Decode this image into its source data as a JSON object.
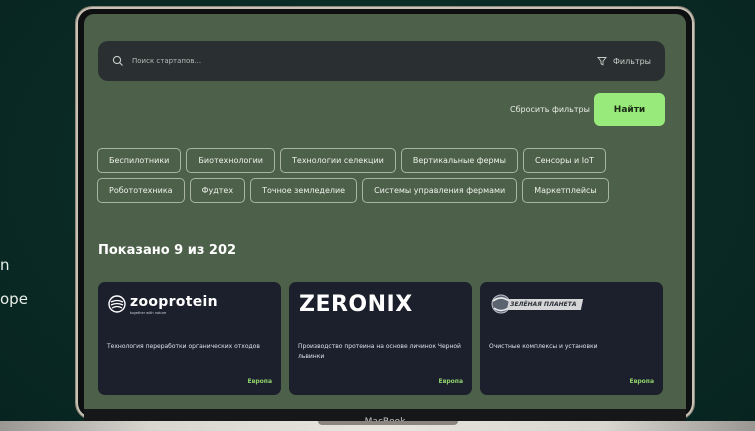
{
  "side_text": {
    "line1": "n",
    "line2": "ope"
  },
  "search": {
    "placeholder": "Поиск стартапов...",
    "value": ""
  },
  "filters": {
    "label": "Фильтры"
  },
  "actions": {
    "reset_label": "Сбросить фильтры",
    "find_label": "Найти"
  },
  "categories": [
    [
      "Беспилотники",
      "Биотехнологии",
      "Технологии селекции",
      "Вертикальные фермы",
      "Сенсоры и IoT"
    ],
    [
      "Робототехника",
      "Фудтех",
      "Точное земледелие",
      "Системы управления фермами",
      "Маркетплейсы"
    ]
  ],
  "results": {
    "title": "Показано 9 из 202"
  },
  "cards": [
    {
      "logo_text": "zooprotein",
      "logo_sub": "together with nature",
      "description": "Технология переработки органических отходов",
      "region": "Европа"
    },
    {
      "logo_text": "ZERONIX",
      "description": "Производство протеина на основе личинок Черной львинки",
      "region": "Европа"
    },
    {
      "logo_text": "ЗЕЛЁНАЯ ПЛАНЕТА",
      "description": "Очистные комплексы и установки",
      "region": "Европа"
    }
  ],
  "device": {
    "label": "MacBook"
  },
  "colors": {
    "accent": "#98ea7b",
    "screen_bg": "#4d6049",
    "card_bg": "#1c1f2c",
    "region": "#8fd36b"
  }
}
